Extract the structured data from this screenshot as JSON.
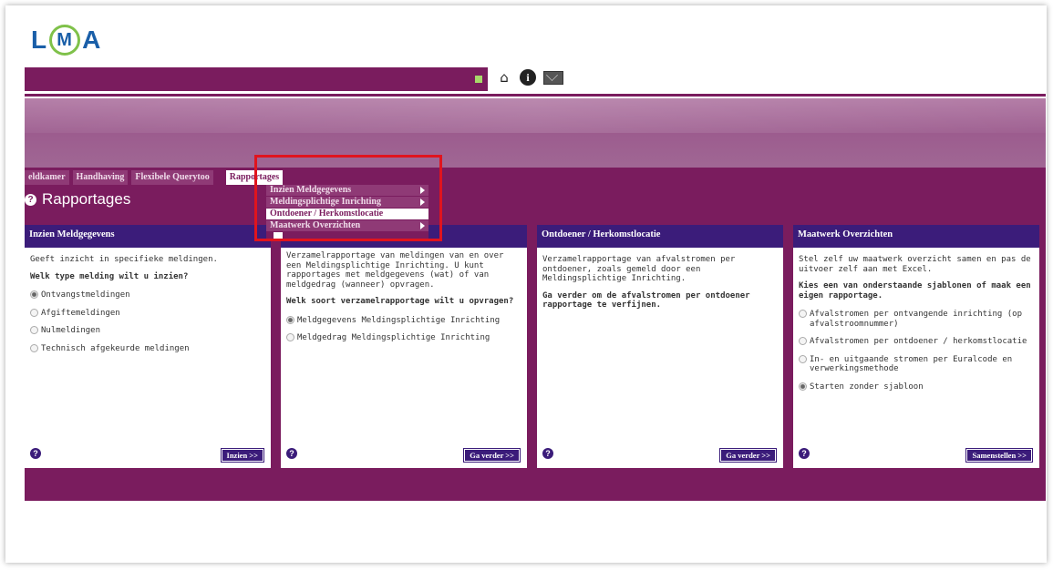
{
  "logo": {
    "text_left": "L",
    "text_mid": "M",
    "text_right": "A"
  },
  "top_icons": [
    "home-icon",
    "info-icon",
    "mail-icon"
  ],
  "nav": {
    "items": [
      "eldkamer",
      "Handhaving",
      "Flexibele Querytoo",
      "Rapportages"
    ],
    "active": "Rapportages"
  },
  "dropdown": {
    "items": [
      {
        "label": "Inzien Meldgegevens",
        "has_submenu": true
      },
      {
        "label": "Meldingsplichtige Inrichting",
        "has_submenu": true
      },
      {
        "label": "Ontdoener / Herkomstlocatie",
        "has_submenu": false
      },
      {
        "label": "Maatwerk Overzichten",
        "has_submenu": true
      }
    ],
    "selected_index": 2
  },
  "page": {
    "title": "Rapportages"
  },
  "panels": [
    {
      "title": "Inzien Meldgegevens",
      "description": "Geeft inzicht in specifieke meldingen.",
      "question": "Welk type melding wilt u inzien?",
      "options": [
        {
          "label": "Ontvangstmeldingen",
          "checked": true
        },
        {
          "label": "Afgiftemeldingen",
          "checked": false
        },
        {
          "label": "Nulmeldingen",
          "checked": false
        },
        {
          "label": "Technisch afgekeurde meldingen",
          "checked": false
        }
      ],
      "button": "Inzien >>"
    },
    {
      "title": "",
      "description": "Verzamelrapportage van meldingen van en over een Meldingsplichtige Inrichting. U kunt rapportages met meldgegevens (wat) of van meldgedrag (wanneer) opvragen.",
      "question": "Welk soort verzamelrapportage wilt u opvragen?",
      "options": [
        {
          "label": "Meldgegevens Meldingsplichtige Inrichting",
          "checked": true
        },
        {
          "label": "Meldgedrag Meldingsplichtige Inrichting",
          "checked": false
        }
      ],
      "button": "Ga verder >>"
    },
    {
      "title": "Ontdoener / Herkomstlocatie",
      "description": "Verzamelrapportage van afvalstromen per ontdoener, zoals gemeld door een Meldingsplichtige Inrichting.",
      "question": "Ga verder om de afvalstromen per ontdoener rapportage te verfijnen.",
      "options": [],
      "button": "Ga verder >>"
    },
    {
      "title": "Maatwerk Overzichten",
      "description": "Stel zelf uw maatwerk overzicht samen en pas de uitvoer zelf aan met Excel.",
      "question": "Kies een van onderstaande sjablonen of maak een eigen rapportage.",
      "options": [
        {
          "label": "Afvalstromen per ontvangende inrichting (op afvalstroomnummer)",
          "checked": false
        },
        {
          "label": "Afvalstromen per ontdoener / herkomstlocatie",
          "checked": false
        },
        {
          "label": "In- en uitgaande stromen per Euralcode en verwerkingsmethode",
          "checked": false
        },
        {
          "label": "Starten zonder sjabloon",
          "checked": true
        }
      ],
      "button": "Samenstellen >>"
    }
  ],
  "colors": {
    "brand_purple": "#7a1c5e",
    "panel_header": "#3b1c7a",
    "highlight_red": "#e0141e"
  }
}
